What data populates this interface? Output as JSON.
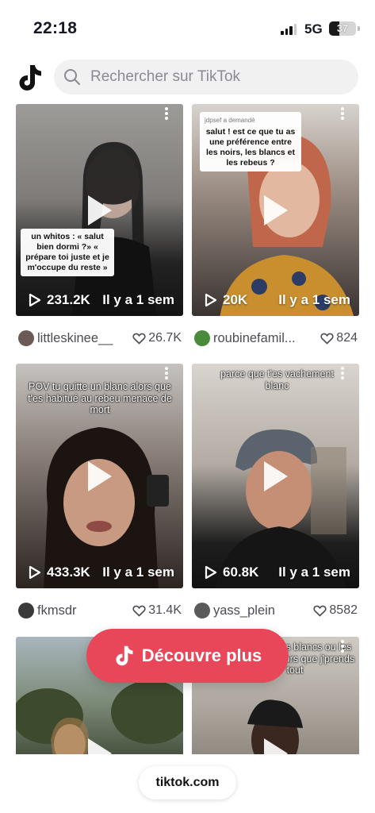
{
  "status_bar": {
    "time": "22:18",
    "network": "5G",
    "battery": "37",
    "battery_level": 0.37
  },
  "search": {
    "placeholder": "Rechercher sur TikTok"
  },
  "videos": [
    {
      "views": "231.2K",
      "age": "Il y a 1 sem",
      "user": "littleskinee__",
      "likes": "26.7K",
      "overlay": "un whitos : « salut bien dormi ?» « prépare toi juste et je m'occupe du reste »",
      "bg": "#8c8a88",
      "avatar_color": "#6b5a55"
    },
    {
      "views": "20K",
      "age": "Il y a 1 sem",
      "user": "roubinefamil...",
      "likes": "824",
      "overlay_header": "jdpsef a demandé",
      "overlay": "salut ! est ce que tu as une préférence entre les noirs, les blancs et les rebeus ?",
      "bg": "#7a6e66",
      "avatar_color": "#4a8a3a"
    },
    {
      "views": "433.3K",
      "age": "Il y a 1 sem",
      "user": "fkmsdr",
      "likes": "31.4K",
      "overlay": "POV tu quitte un blanc alors que t'es habitué au rebeu menace de mort",
      "bg": "#5e4a42",
      "avatar_color": "#3a3a3a"
    },
    {
      "views": "60.8K",
      "age": "Il y a 1 sem",
      "user": "yass_plein",
      "likes": "8582",
      "overlay": "parce que t'es vachement blanc",
      "bg": "#b9b3ab",
      "avatar_color": "#5a5a5a"
    },
    {
      "overlay": "",
      "bg": "#7c8a8e"
    },
    {
      "overlay": "les noirs les blancs ou les rebeus » alors que j'prends tout",
      "bg": "#9a928a"
    }
  ],
  "discover": {
    "label": "Découvre plus"
  },
  "footer": {
    "url": "tiktok.com"
  },
  "colors": {
    "accent": "#e8475a",
    "text_secondary": "#4b4c53",
    "search_bg": "#f1f1f2"
  }
}
